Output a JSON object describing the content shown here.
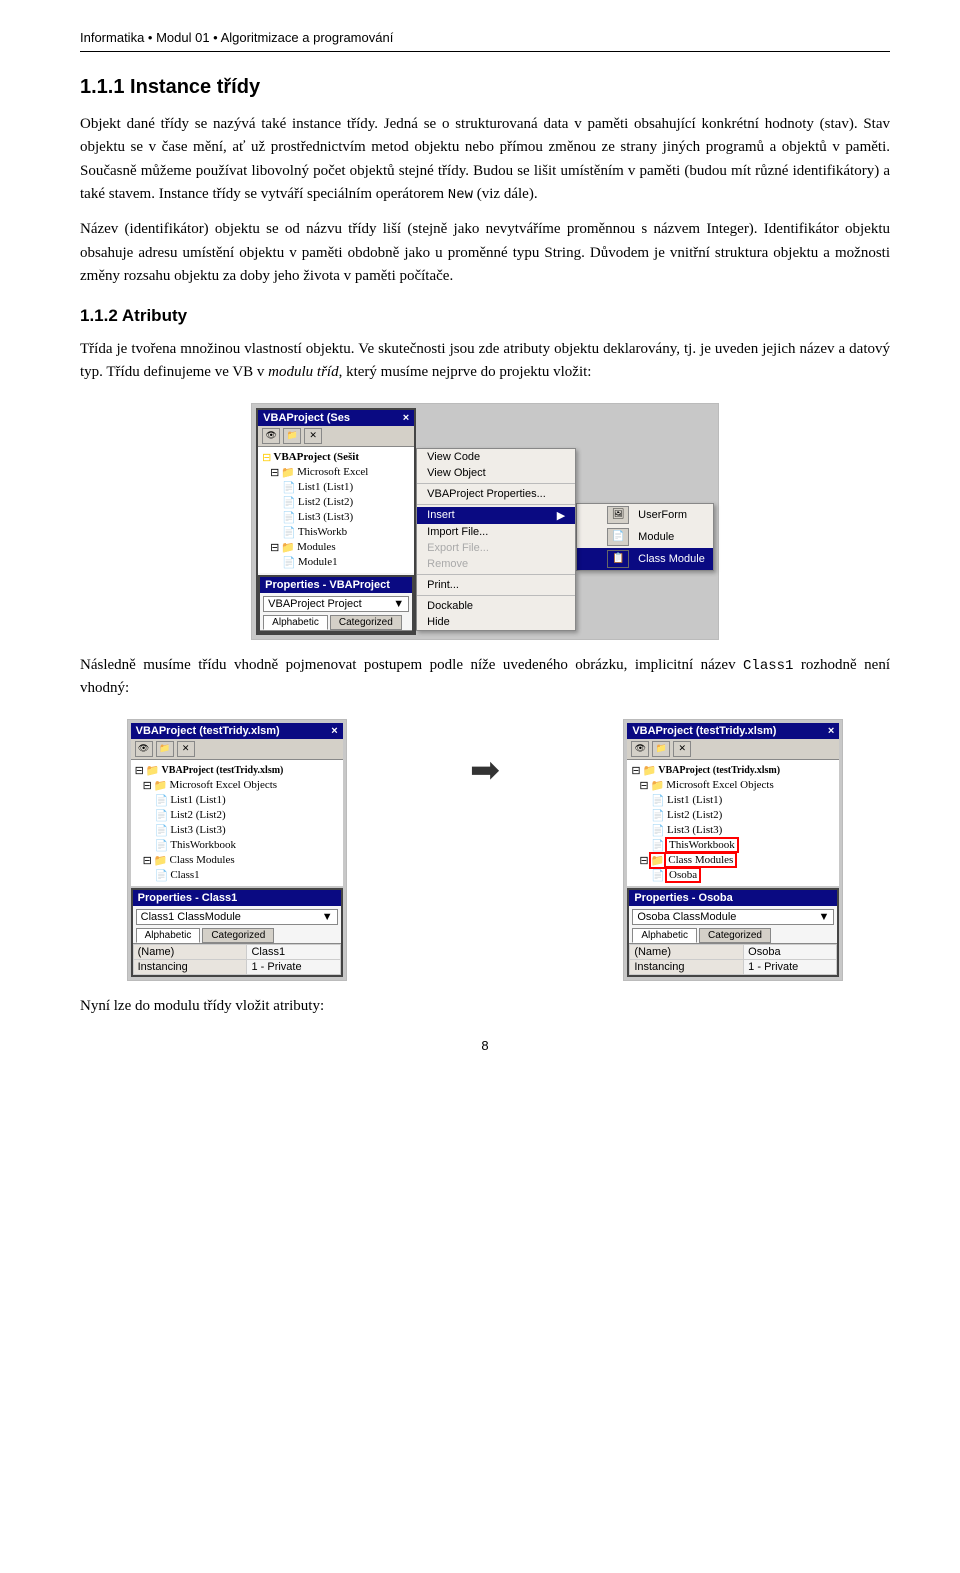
{
  "breadcrumb": "Informatika • Modul 01 • Algoritmizace a programování",
  "section1": {
    "heading": "1.1.1  Instance třídy",
    "para1": "Objekt dané třídy se nazývá také instance třídy. Jedná se o strukturovaná data v paměti obsahující konkrétní hodnoty (stav). Stav objektu se v čase mění, ať už prostřednictvím metod objektu nebo přímou změnou ze strany jiných programů a objektů v paměti. Současně můžeme používat libovolný počet objektů stejné třídy. Budou se lišit umístěním v paměti (budou mít různé identifikátory) a také stavem. Instance třídy se vytváří speciálním operátorem New (viz dále).",
    "para2_prefix": "Název (identifikátor) objektu se od názvu třídy liší (stejně jako nevytváříme proměnnou s názvem Integer). Identifikátor objektu obsahuje adresu umístění objektu v paměti obdobně jako u proměnné typu String. Důvodem je vnitřní struktura objektu a možnosti změny rozsahu objektu za doby jeho života v paměti počítače."
  },
  "section2": {
    "heading": "1.1.2  Atributy",
    "para1": "Třída je tvořena množinou vlastností objektu. Ve skutečnosti jsou zde atributy objektu deklarovány, tj. je uveden jejich název a datový typ. Třídu definujeme ve VB v modulu tříd, který musíme nejprve do projektu vložit:",
    "caption1": "Následně musíme třídu vhodně pojmenovat postupem podle níže uvedeného obrázku, implicitní název Class1 rozhodně není vhodný:",
    "caption2": "Nyní lze do modulu třídy vložit atributy:"
  },
  "vba_screenshot1": {
    "title": "VBAProject (Ses",
    "tree": [
      {
        "indent": 0,
        "icon": "📁",
        "label": "VBAProject (Sešit",
        "bold": true
      },
      {
        "indent": 1,
        "icon": "📁",
        "label": "Microsoft Excel"
      },
      {
        "indent": 2,
        "icon": "📄",
        "label": "List1 (List1)"
      },
      {
        "indent": 2,
        "icon": "📄",
        "label": "List2 (List2)"
      },
      {
        "indent": 2,
        "icon": "📄",
        "label": "List3 (List3)"
      },
      {
        "indent": 2,
        "icon": "📄",
        "label": "ThisWorkb"
      },
      {
        "indent": 1,
        "icon": "📁",
        "label": "Modules"
      },
      {
        "indent": 2,
        "icon": "📄",
        "label": "Module1"
      }
    ],
    "context_menu": {
      "items": [
        {
          "label": "View Code",
          "type": "normal"
        },
        {
          "label": "View Object",
          "type": "normal"
        },
        {
          "separator": true
        },
        {
          "label": "VBAProject Properties...",
          "type": "normal"
        },
        {
          "separator": true
        },
        {
          "label": "Insert",
          "type": "highlight",
          "arrow": true
        },
        {
          "label": "Import File...",
          "type": "normal"
        },
        {
          "label": "Export File...",
          "type": "disabled"
        },
        {
          "label": "Remove",
          "type": "disabled"
        },
        {
          "separator": true
        },
        {
          "label": "Print...",
          "type": "normal"
        },
        {
          "separator": true
        },
        {
          "label": "Dockable",
          "type": "normal"
        },
        {
          "label": "Hide",
          "type": "normal"
        }
      ]
    },
    "submenu": {
      "items": [
        {
          "label": "UserForm",
          "icon": "form"
        },
        {
          "label": "Module",
          "icon": "module"
        },
        {
          "label": "Class Module",
          "icon": "class",
          "highlight": true
        }
      ]
    },
    "properties": {
      "title": "Properties - VBAProject",
      "dropdown_label": "VBAProject  Project",
      "tabs": [
        "Alphabetic",
        "Categorized"
      ],
      "active_tab": "Alphabetic"
    }
  },
  "vba_screenshot2_left": {
    "title": "VBAProject (testTridy.xlsm)",
    "tree": [
      {
        "indent": 0,
        "icon": "📁",
        "label": "VBAProject (testTridy.xlsm)",
        "bold": true
      },
      {
        "indent": 1,
        "icon": "📁",
        "label": "Microsoft Excel Objects"
      },
      {
        "indent": 2,
        "icon": "📄",
        "label": "List1 (List1)"
      },
      {
        "indent": 2,
        "icon": "📄",
        "label": "List2 (List2)"
      },
      {
        "indent": 2,
        "icon": "📄",
        "label": "List3 (List3)"
      },
      {
        "indent": 2,
        "icon": "📄",
        "label": "ThisWorkbook"
      },
      {
        "indent": 1,
        "icon": "📁",
        "label": "Class Modules"
      },
      {
        "indent": 2,
        "icon": "📄",
        "label": "Class1"
      }
    ],
    "properties": {
      "title": "Properties - Class1",
      "dropdown_label": "Class1  ClassModule",
      "tabs": [
        "Alphabetic",
        "Categorized"
      ],
      "active_tab": "Alphabetic",
      "rows": [
        [
          "(Name)",
          "Class1"
        ],
        [
          "Instancing",
          "1 - Private"
        ]
      ]
    }
  },
  "vba_screenshot2_right": {
    "title": "VBAProject (testTridy.xlsm)",
    "tree": [
      {
        "indent": 0,
        "icon": "📁",
        "label": "VBAProject (testTridy.xlsm)",
        "bold": true
      },
      {
        "indent": 1,
        "icon": "📁",
        "label": "Microsoft Excel Objects"
      },
      {
        "indent": 2,
        "icon": "📄",
        "label": "List1 (List1)"
      },
      {
        "indent": 2,
        "icon": "📄",
        "label": "List2 (List2)"
      },
      {
        "indent": 2,
        "icon": "📄",
        "label": "List3 (List3)"
      },
      {
        "indent": 2,
        "icon": "📄",
        "label": "ThisWorkbook",
        "circled": true
      },
      {
        "indent": 1,
        "icon": "📁",
        "label": "Class Modules",
        "circled": true
      },
      {
        "indent": 2,
        "icon": "📄",
        "label": "Osoba",
        "circled": true
      }
    ],
    "properties": {
      "title": "Properties - Osoba",
      "dropdown_label": "Osoba  ClassModule",
      "tabs": [
        "Alphabetic",
        "Categorized"
      ],
      "active_tab": "Alphabetic",
      "rows": [
        [
          "(Name)",
          "Osoba"
        ],
        [
          "Instancing",
          "1 - Private"
        ]
      ]
    }
  },
  "page_number": "8",
  "icons": {
    "userform": "🖼",
    "module": "📄",
    "classmodule": "📋",
    "folder": "📁",
    "file": "📄"
  }
}
